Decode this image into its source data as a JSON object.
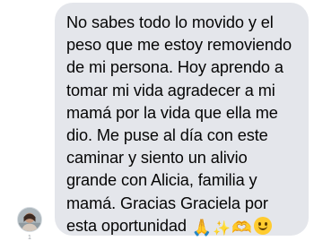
{
  "message": {
    "text": "No sabes todo lo movido y el\npeso que me estoy removiendo\nde mi persona. Hoy aprendo a\ntomar mi vida agradecer a mi\nmamá por la vida que ella me\ndio. Me puse al día con este\ncaminar y siento un alivio\ngrande con Alicia, familia y\nmamá. Gracias Graciela por\nesta oportunidad",
    "emojis": [
      "🙏",
      "✨",
      "🫶"
    ],
    "bubble_color": "#e4e6eb",
    "text_color": "#050505"
  },
  "sender": {
    "avatar": "avatar-photo"
  },
  "status": {
    "indicator": "1"
  }
}
